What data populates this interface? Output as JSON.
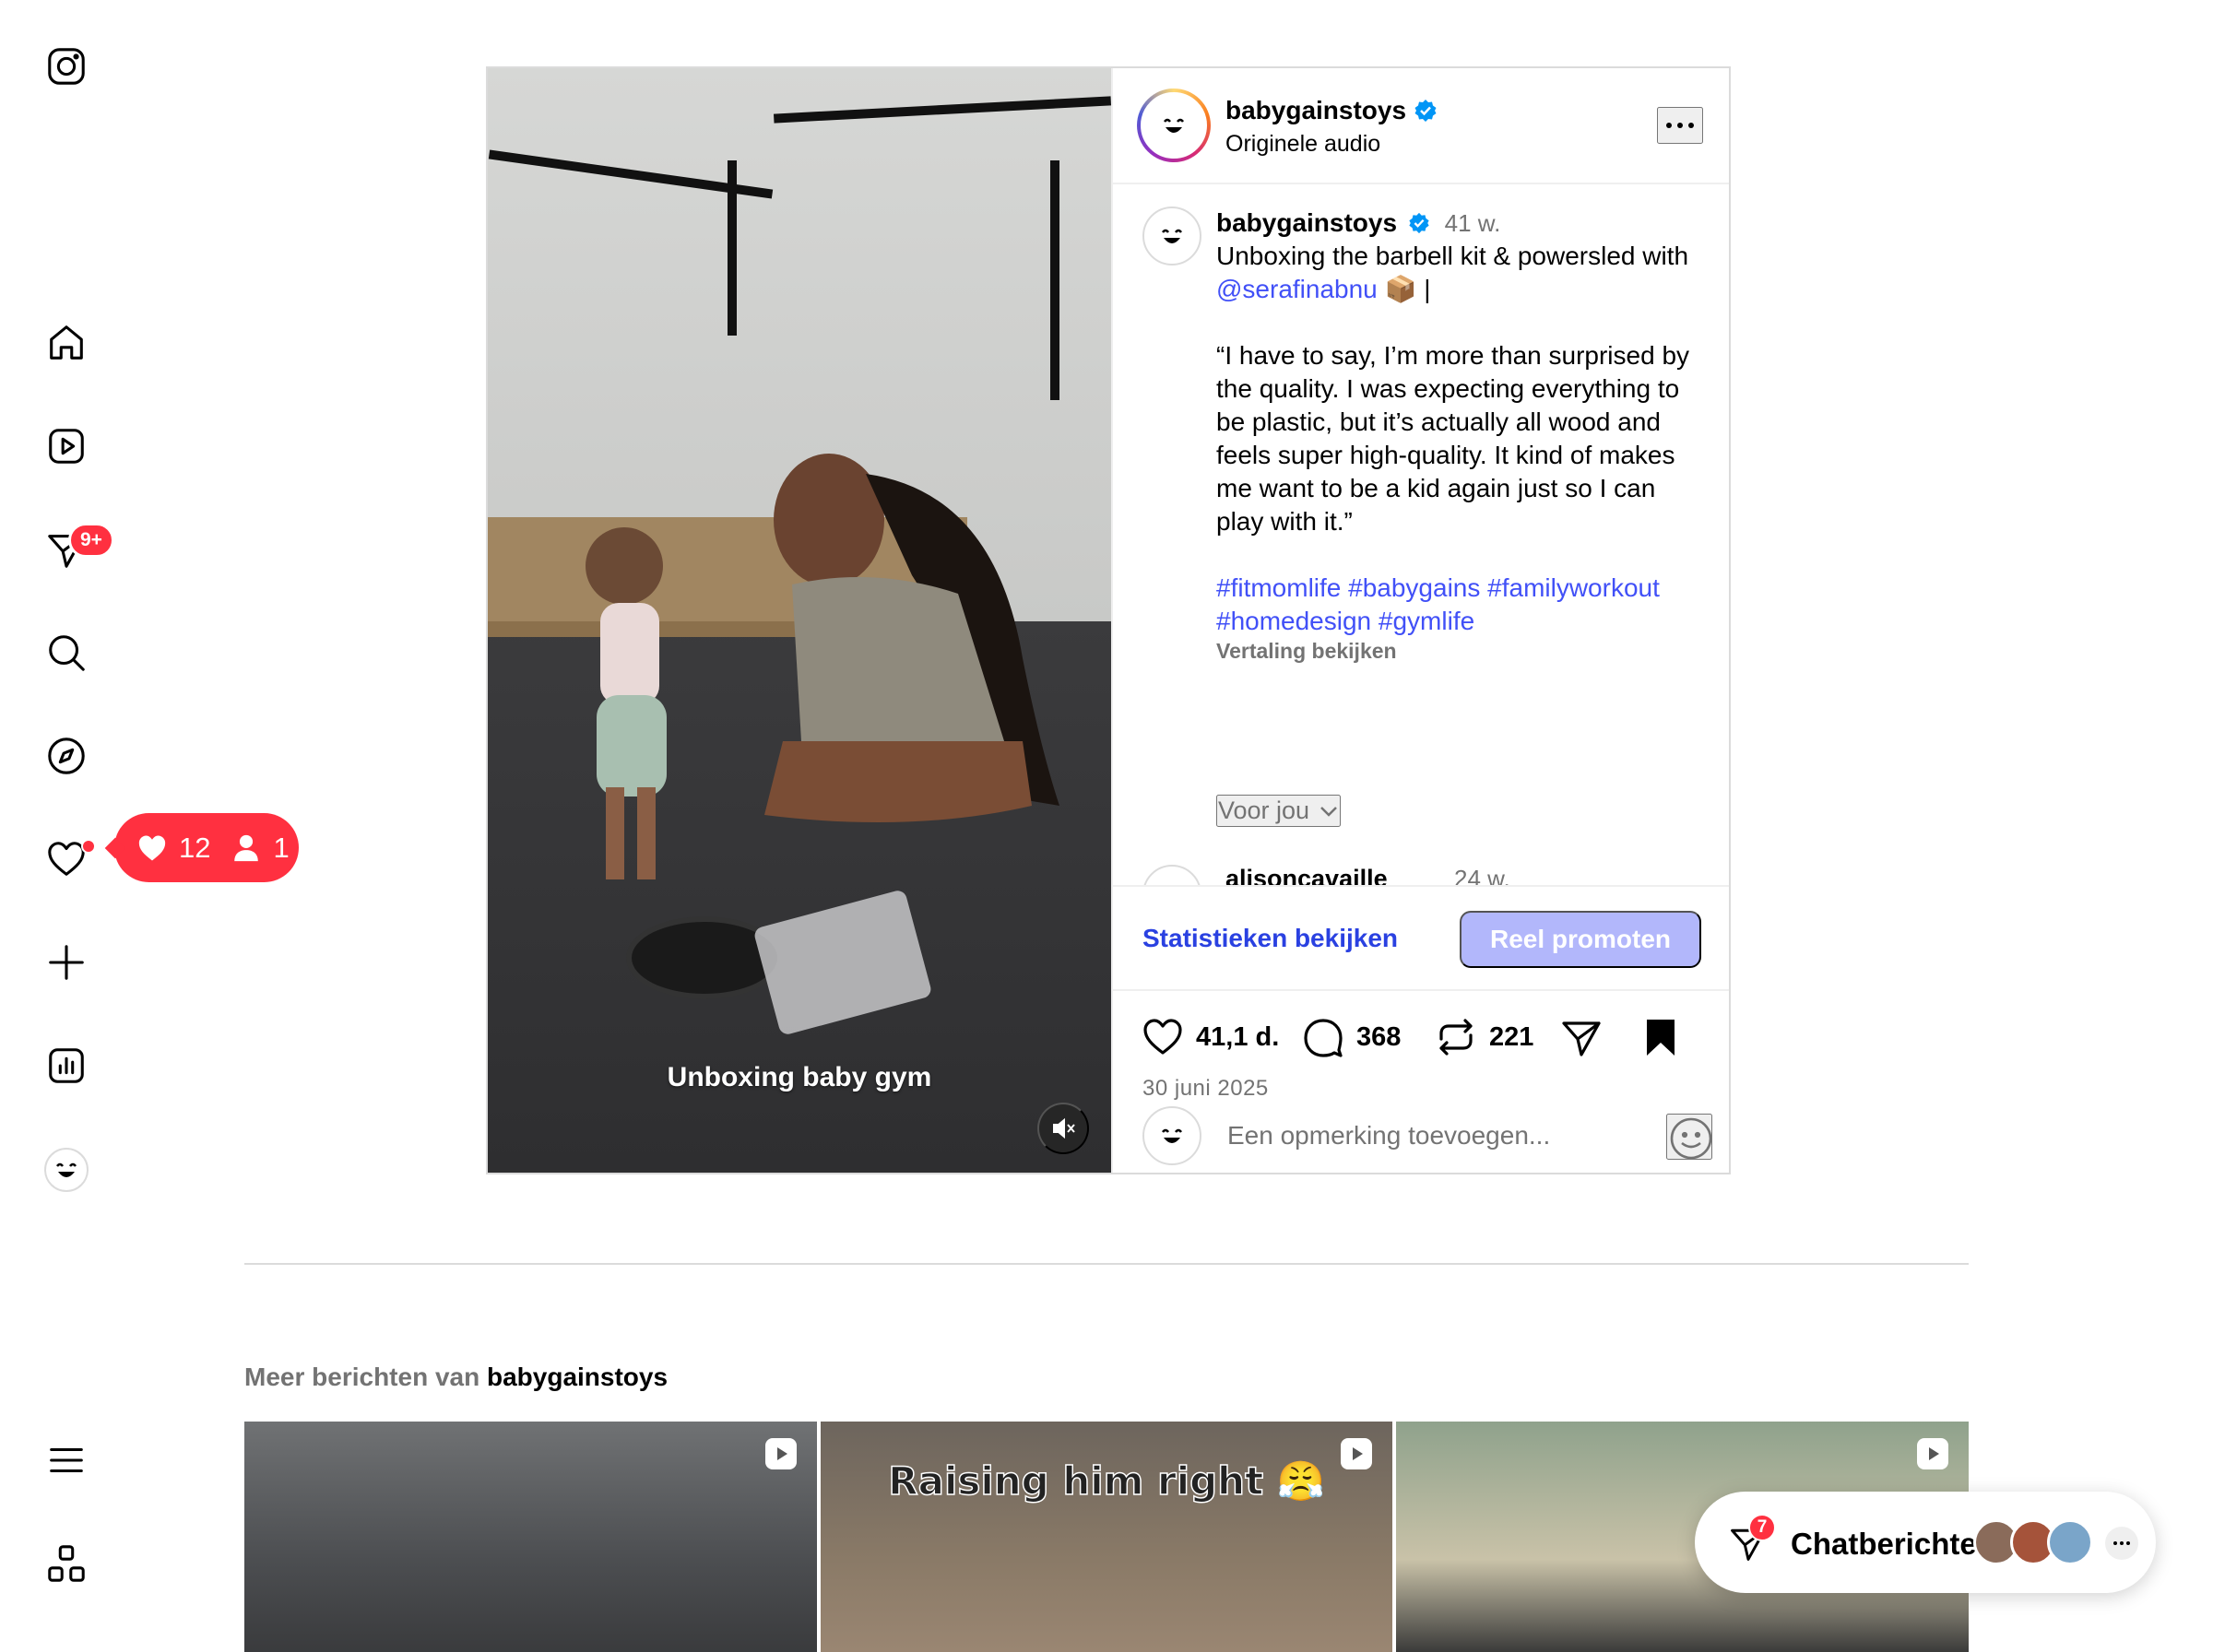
{
  "sidebar": {
    "items": [
      {
        "name": "instagram-logo-icon"
      },
      {
        "name": "home-icon"
      },
      {
        "name": "reels-icon"
      },
      {
        "name": "messages-icon"
      },
      {
        "name": "search-icon"
      },
      {
        "name": "explore-icon"
      },
      {
        "name": "notifications-icon"
      },
      {
        "name": "create-icon"
      },
      {
        "name": "insights-icon"
      },
      {
        "name": "profile-icon"
      },
      {
        "name": "menu-icon"
      },
      {
        "name": "more-apps-icon"
      }
    ],
    "messages_badge": "9+",
    "notif_likes": "12",
    "notif_follows": "1"
  },
  "post": {
    "username": "babygainstoys",
    "audio": "Originele audio",
    "media_caption": "Unboxing baby gym",
    "caption": {
      "username": "babygainstoys",
      "time": "41 w.",
      "line1": "Unboxing the barbell kit & powersled with",
      "mention": "@serafinabnu",
      "after_mention": " 📦 |",
      "quote": "“I have to say, I’m more than surprised by the quality. I was expecting everything to be plastic, but it’s actually all wood and feels super high-quality. It kind of makes me want to be a kid again just so I can play with it.”",
      "hashtags": "#fitmomlife #babygains #familyworkout #homedesign #gymlife",
      "translate": "Vertaling bekijken"
    },
    "voor_jou": "Voor jou",
    "next_comment": {
      "username": "alisoncavaille",
      "time": "24 w."
    },
    "stats_link": "Statistieken bekijken",
    "promote_button": "Reel promoten",
    "likes": "41,1 d.",
    "comments": "368",
    "reposts": "221",
    "date": "30 juni 2025",
    "comment_placeholder": "Een opmerking toevoegen..."
  },
  "more": {
    "prefix": "Meer berichten van",
    "username": "babygainstoys",
    "tile2_text": "Raising him right 😤"
  },
  "chat": {
    "label": "Chatberichten",
    "badge": "7"
  },
  "colors": {
    "accent_blue": "#4150f7",
    "badge_red": "#ff3040",
    "promote_bg": "#b2b7fb",
    "verified_blue": "#0095f6"
  }
}
